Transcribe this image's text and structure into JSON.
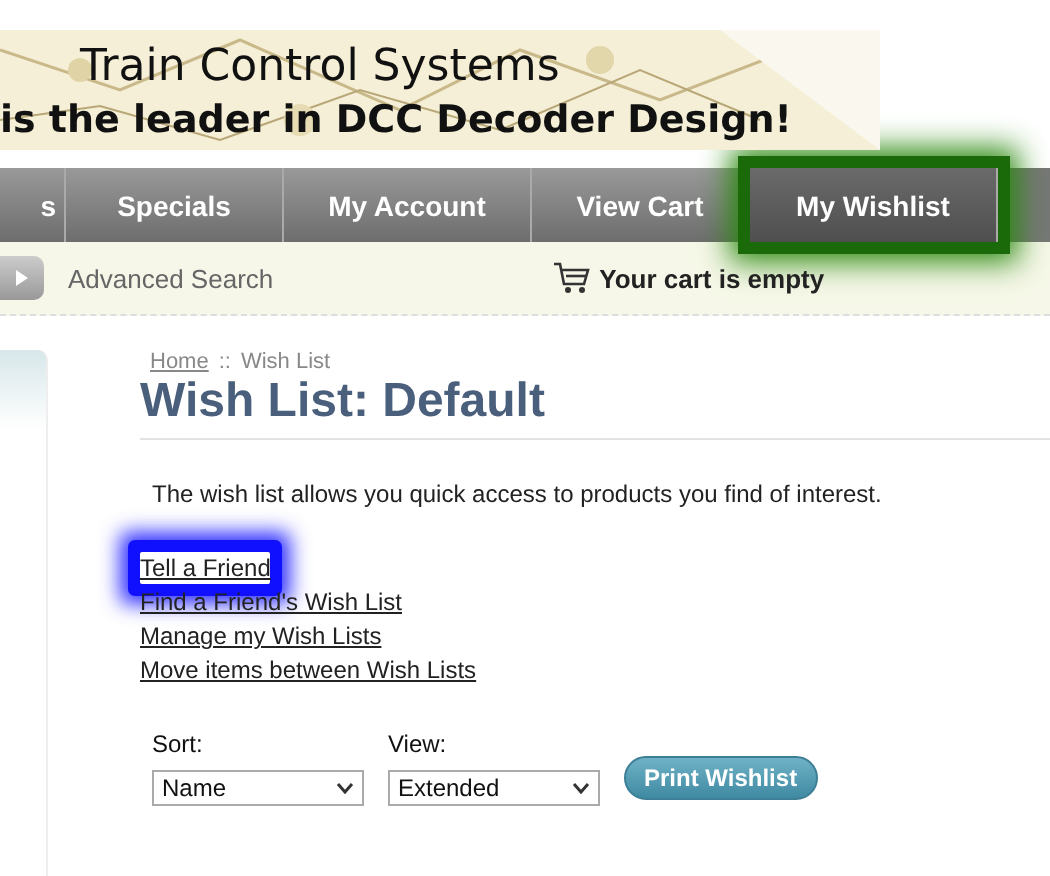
{
  "banner": {
    "title": "Train Control Systems",
    "tagline": "is the leader in DCC Decoder Design!"
  },
  "nav": [
    {
      "label": "s",
      "selected": false,
      "highlighted": false
    },
    {
      "label": "Specials",
      "selected": false,
      "highlighted": false
    },
    {
      "label": "My Account",
      "selected": false,
      "highlighted": false
    },
    {
      "label": "View Cart",
      "selected": false,
      "highlighted": false
    },
    {
      "label": "My Wishlist",
      "selected": true,
      "highlighted": true
    }
  ],
  "subbar": {
    "advanced_search": "Advanced Search",
    "cart": "Your cart is empty"
  },
  "breadcrumb": {
    "home": "Home",
    "separator": "::",
    "current": "Wish List"
  },
  "heading": "Wish List: Default",
  "intro": "The wish list allows you quick access to products you find of interest.",
  "links": [
    {
      "label": "Tell a Friend",
      "highlighted": true
    },
    {
      "label": "Find a Friend's Wish List",
      "highlighted": false
    },
    {
      "label": "Manage my Wish Lists",
      "highlighted": false
    },
    {
      "label": "Move items between Wish Lists",
      "highlighted": false
    }
  ],
  "controls": {
    "sort_label": "Sort:",
    "sort_value": "Name",
    "view_label": "View:",
    "view_value": "Extended",
    "print_button": "Print Wishlist"
  }
}
